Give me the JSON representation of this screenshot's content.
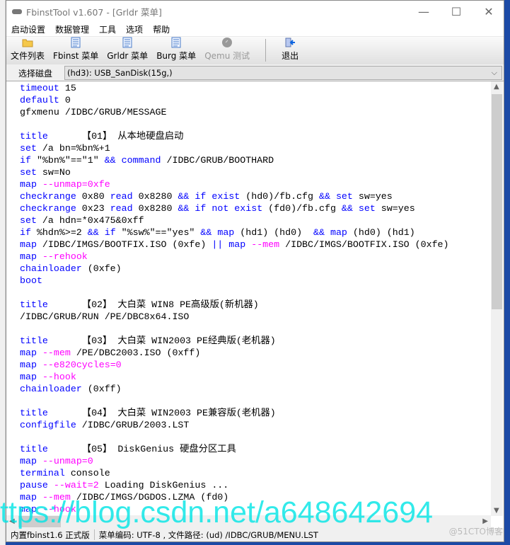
{
  "window": {
    "title": "FbinstTool v1.607 - [Grldr 菜单]",
    "minimize": "—",
    "maximize": "☐",
    "close": "✕"
  },
  "menu": [
    "启动设置",
    "数据管理",
    "工具",
    "选项",
    "帮助"
  ],
  "toolbar": [
    {
      "label": "文件列表",
      "icon": "folder-icon",
      "enabled": true
    },
    {
      "label": "Fbinst 菜单",
      "icon": "document-icon",
      "enabled": true
    },
    {
      "label": "Grldr 菜单",
      "icon": "document-icon",
      "enabled": true
    },
    {
      "label": "Burg 菜单",
      "icon": "document-icon",
      "enabled": true
    },
    {
      "label": "Qemu 测试",
      "icon": "disc-icon",
      "enabled": false
    },
    {
      "label": "退出",
      "icon": "exit-door-icon",
      "enabled": true
    }
  ],
  "disk": {
    "label": "选择磁盘",
    "selected": "(hd3): USB_SanDisk(15g,)"
  },
  "colors": {
    "keyword": "#0000ff",
    "option": "#ff00ff"
  },
  "code": [
    [
      [
        "timeout",
        "k"
      ],
      [
        " 15",
        ""
      ]
    ],
    [
      [
        "default",
        "k"
      ],
      [
        " 0",
        ""
      ]
    ],
    [
      [
        "gfxmenu /IDBC/GRUB/MESSAGE",
        ""
      ]
    ],
    [],
    [
      [
        "title",
        "k"
      ],
      [
        "      【01】 从本地硬盘启动",
        ""
      ]
    ],
    [
      [
        "set",
        "k"
      ],
      [
        " /a bn=%bn%+1",
        ""
      ]
    ],
    [
      [
        "if",
        "k"
      ],
      [
        " \"%bn%\"==\"1\" ",
        ""
      ],
      [
        "&&",
        "k"
      ],
      [
        " ",
        ""
      ],
      [
        "command",
        "k"
      ],
      [
        " /IDBC/GRUB/BOOTHARD",
        ""
      ]
    ],
    [
      [
        "set",
        "k"
      ],
      [
        " sw=No",
        ""
      ]
    ],
    [
      [
        "map",
        "k"
      ],
      [
        " ",
        ""
      ],
      [
        "--unmap=0xfe",
        "o"
      ]
    ],
    [
      [
        "checkrange",
        "k"
      ],
      [
        " 0x80 ",
        ""
      ],
      [
        "read",
        "k"
      ],
      [
        " 0x8280 ",
        ""
      ],
      [
        "&&",
        "k"
      ],
      [
        " ",
        ""
      ],
      [
        "if",
        "k"
      ],
      [
        " ",
        ""
      ],
      [
        "exist",
        "k"
      ],
      [
        " (hd0)/fb.cfg ",
        ""
      ],
      [
        "&&",
        "k"
      ],
      [
        " ",
        ""
      ],
      [
        "set",
        "k"
      ],
      [
        " sw=yes",
        ""
      ]
    ],
    [
      [
        "checkrange",
        "k"
      ],
      [
        " 0x23 ",
        ""
      ],
      [
        "read",
        "k"
      ],
      [
        " 0x8280 ",
        ""
      ],
      [
        "&&",
        "k"
      ],
      [
        " ",
        ""
      ],
      [
        "if",
        "k"
      ],
      [
        " ",
        ""
      ],
      [
        "not",
        "k"
      ],
      [
        " ",
        ""
      ],
      [
        "exist",
        "k"
      ],
      [
        " (fd0)/fb.cfg ",
        ""
      ],
      [
        "&&",
        "k"
      ],
      [
        " ",
        ""
      ],
      [
        "set",
        "k"
      ],
      [
        " sw=yes",
        ""
      ]
    ],
    [
      [
        "set",
        "k"
      ],
      [
        " /a hdn=*0x475&0xff",
        ""
      ]
    ],
    [
      [
        "if",
        "k"
      ],
      [
        " %hdn%>=2 ",
        ""
      ],
      [
        "&&",
        "k"
      ],
      [
        " ",
        ""
      ],
      [
        "if",
        "k"
      ],
      [
        " \"%sw%\"==\"yes\" ",
        ""
      ],
      [
        "&&",
        "k"
      ],
      [
        " ",
        ""
      ],
      [
        "map",
        "k"
      ],
      [
        " (hd1) (hd0)  ",
        ""
      ],
      [
        "&&",
        "k"
      ],
      [
        " ",
        ""
      ],
      [
        "map",
        "k"
      ],
      [
        " (hd0) (hd1)",
        ""
      ]
    ],
    [
      [
        "map",
        "k"
      ],
      [
        " /IDBC/IMGS/BOOTFIX.ISO (0xfe) ",
        ""
      ],
      [
        "||",
        "k"
      ],
      [
        " ",
        ""
      ],
      [
        "map",
        "k"
      ],
      [
        " ",
        ""
      ],
      [
        "--mem",
        "o"
      ],
      [
        " /IDBC/IMGS/BOOTFIX.ISO (0xfe)",
        ""
      ]
    ],
    [
      [
        "map",
        "k"
      ],
      [
        " ",
        ""
      ],
      [
        "--rehook",
        "o"
      ]
    ],
    [
      [
        "chainloader",
        "k"
      ],
      [
        " (0xfe)",
        ""
      ]
    ],
    [
      [
        "boot",
        "k"
      ]
    ],
    [],
    [
      [
        "title",
        "k"
      ],
      [
        "      【02】 大白菜 WIN8 PE高级版(新机器)",
        ""
      ]
    ],
    [
      [
        "/IDBC/GRUB/RUN /PE/DBC8x64.ISO",
        ""
      ]
    ],
    [],
    [
      [
        "title",
        "k"
      ],
      [
        "      【03】 大白菜 WIN2003 PE经典版(老机器)",
        ""
      ]
    ],
    [
      [
        "map",
        "k"
      ],
      [
        " ",
        ""
      ],
      [
        "--mem",
        "o"
      ],
      [
        " /PE/DBC2003.ISO (0xff)",
        ""
      ]
    ],
    [
      [
        "map",
        "k"
      ],
      [
        " ",
        ""
      ],
      [
        "--e820cycles=0",
        "o"
      ]
    ],
    [
      [
        "map",
        "k"
      ],
      [
        " ",
        ""
      ],
      [
        "--hook",
        "o"
      ]
    ],
    [
      [
        "chainloader",
        "k"
      ],
      [
        " (0xff)",
        ""
      ]
    ],
    [],
    [
      [
        "title",
        "k"
      ],
      [
        "      【04】 大白菜 WIN2003 PE兼容版(老机器)",
        ""
      ]
    ],
    [
      [
        "configfile",
        "k"
      ],
      [
        " /IDBC/GRUB/2003.LST",
        ""
      ]
    ],
    [],
    [
      [
        "title",
        "k"
      ],
      [
        "      【05】 DiskGenius 硬盘分区工具",
        ""
      ]
    ],
    [
      [
        "map",
        "k"
      ],
      [
        " ",
        ""
      ],
      [
        "--unmap=0",
        "o"
      ]
    ],
    [
      [
        "terminal",
        "k"
      ],
      [
        " console",
        ""
      ]
    ],
    [
      [
        "pause",
        "k"
      ],
      [
        " ",
        ""
      ],
      [
        "--wait=2",
        "o"
      ],
      [
        " Loading DiskGenius ...",
        ""
      ]
    ],
    [
      [
        "map",
        "k"
      ],
      [
        " ",
        ""
      ],
      [
        "--mem",
        "o"
      ],
      [
        " /IDBC/IMGS/DGDOS.LZMA (fd0)",
        ""
      ]
    ],
    [
      [
        "map",
        "k"
      ],
      [
        " ",
        ""
      ],
      [
        "--hook",
        "o"
      ]
    ]
  ],
  "status": {
    "version": "内置fbinst1.6 正式版",
    "info": "菜单编码: UTF-8 , 文件路径: (ud) /IDBC/GRUB/MENU.LST"
  },
  "watermark": {
    "url": "ttps://blog.csdn.net/a648642694",
    "site": "@51CTO博客"
  }
}
